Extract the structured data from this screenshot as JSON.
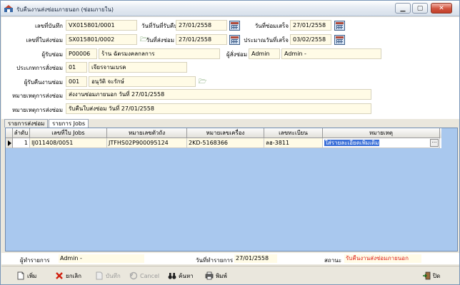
{
  "window": {
    "title": "รับคืนงานส่งซ่อมภายนอก (ซ่อมภายใน)",
    "controls": {
      "minimize": "▁",
      "maximize": "▢",
      "close": "✕"
    }
  },
  "form": {
    "doc_no": {
      "label": "เลขที่บันทึก",
      "value": "VX015801/0001"
    },
    "receive_date": {
      "label": "วันที่วันที่รับคืน",
      "value": "27/01/2558"
    },
    "finish_date": {
      "label": "วันที่ซ่อมเสร็จ",
      "value": "27/01/2558"
    },
    "send_no": {
      "label": "เลขที่ใบส่งซ่อม",
      "value": "SX015801/0002"
    },
    "send_date": {
      "label": "วันที่ส่งซ่อม",
      "value": "27/01/2558"
    },
    "estimate_date": {
      "label": "ประมาณวันที่เสร็จ",
      "value": "03/02/2558"
    },
    "vendor": {
      "label": "ผู้รับซ่อม",
      "code": "P00006",
      "name": "ร้าน ฉัตรมงคลกลการ"
    },
    "orderer": {
      "label": "ผู้สั่งซ่อม",
      "code": "Admin",
      "name": "Admin -"
    },
    "repair_type": {
      "label": "ประเภทการสั่งซ่อม",
      "code": "01",
      "name": "เจียรจานเบรค"
    },
    "receiver": {
      "label": "ผู้รับคืนงานซ่อม",
      "code": "001",
      "name": "อนุวัติ จะรักษ์"
    },
    "remark_send": {
      "label": "หมายเหตุการส่งซ่อม",
      "value": "ส่งงานซ่อมภายนอก วันที่ 27/01/2558"
    },
    "remark_receive": {
      "label": "หมายเหตุการส่งซ่อม",
      "value": "รับคืนใบส่งซ่อม วันที่ 27/01/2558"
    }
  },
  "tabs": [
    {
      "label": "รายการส่งซ่อม",
      "active": false
    },
    {
      "label": "รายการ Jobs",
      "active": true
    }
  ],
  "grid": {
    "columns": [
      "ลำดับ",
      "เลขที่ใบ Jobs",
      "หมายเลขตัวถัง",
      "หมายเลขเครื่อง",
      "เลขทะเบียน",
      "หมายเหตุ"
    ],
    "rows": [
      {
        "seq": "1",
        "job_no": "IJ011408/0051",
        "chassis": "JTFHS02P900095124",
        "engine": "2KD-5168366",
        "plate": "ลฮ-3811",
        "remark": "ใส่รายละเอียดเพิ่มเติม"
      }
    ]
  },
  "status": {
    "maker_label": "ผู้ทำรายการ",
    "maker_value": "Admin -",
    "date_label": "วันที่ทำรายการ",
    "date_value": "27/01/2558",
    "state_label": "สถานะ",
    "state_value": "รับคืนงานส่งซ่อมภายนอก",
    "state_color": "#e0201a"
  },
  "toolbar": {
    "add": "เพิ่ม",
    "cancel_doc": "ยกเลิก",
    "save": "บันทึก",
    "cancel": "Cancel",
    "search": "ค้นหา",
    "print": "พิมพ์",
    "close": "ปิด"
  },
  "colors": {
    "field_bg": "#fffbe6",
    "grid_bg": "#a9c8ee",
    "selection": "#3a6fd8"
  }
}
